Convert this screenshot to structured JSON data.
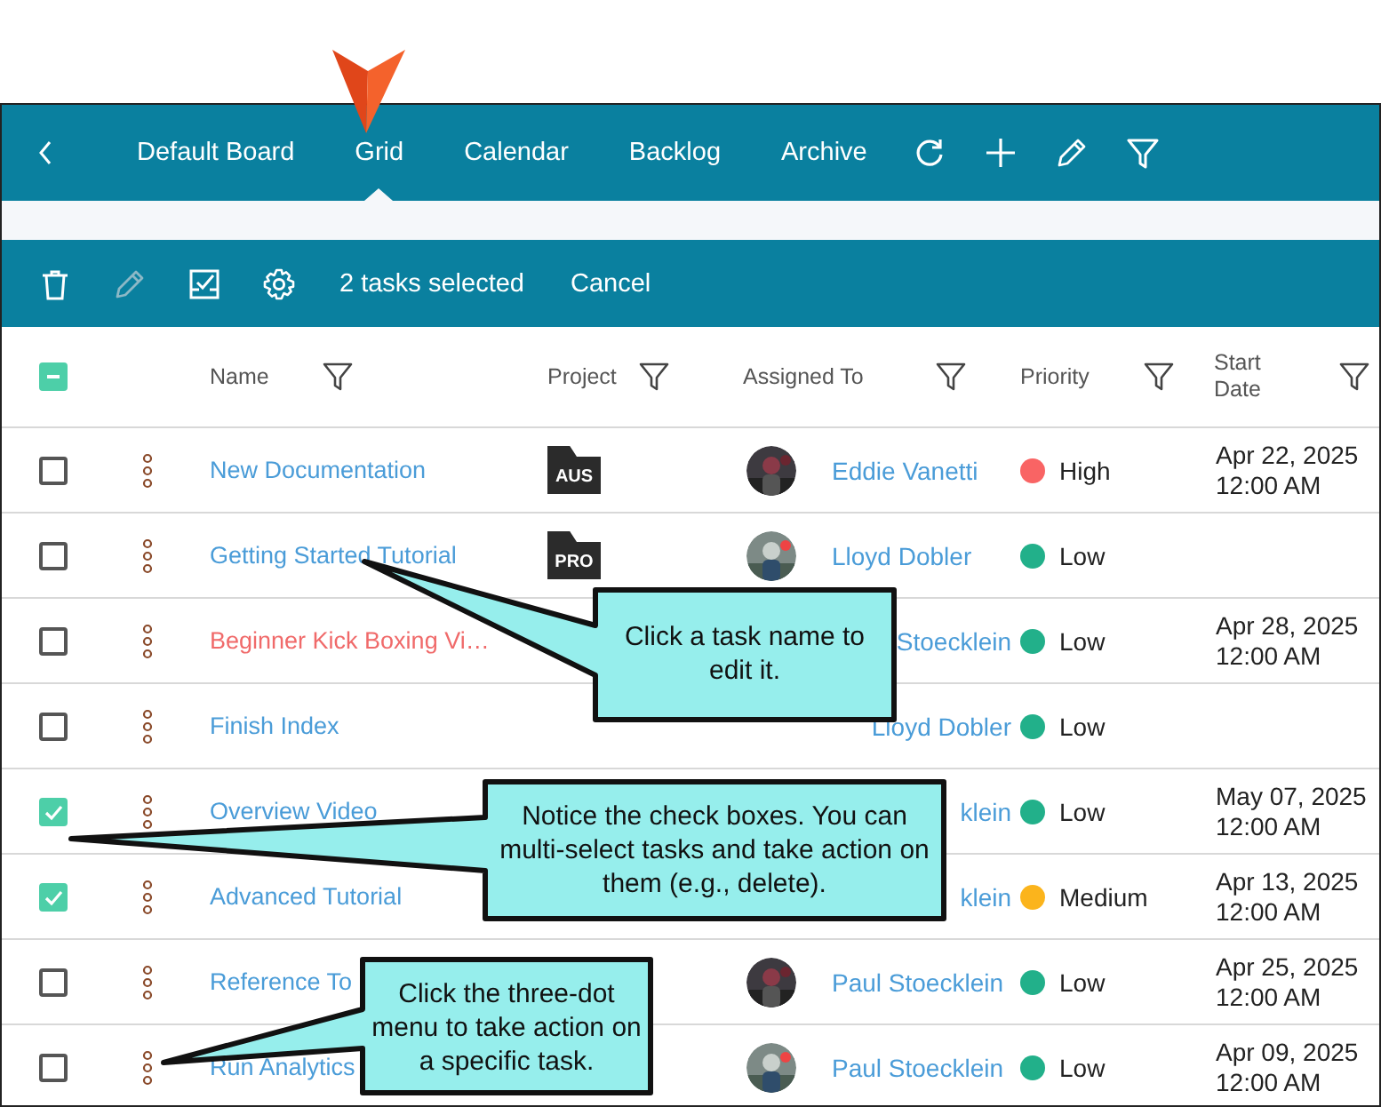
{
  "nav": {
    "tabs": [
      {
        "label": "Default Board",
        "selected": false
      },
      {
        "label": "Grid",
        "selected": true
      },
      {
        "label": "Calendar",
        "selected": false
      },
      {
        "label": "Backlog",
        "selected": false
      },
      {
        "label": "Archive",
        "selected": false
      }
    ]
  },
  "toolbar": {
    "edit_disabled": true,
    "selection_text": "2 tasks selected",
    "cancel": "Cancel"
  },
  "table": {
    "select_all_indeterminate": true,
    "columns": [
      "Name",
      "Project",
      "Assigned To",
      "Priority",
      "Start Date"
    ],
    "rows": [
      {
        "checked": false,
        "name": "New Documentation",
        "alert": false,
        "project": "AUS",
        "avatar": true,
        "assignee": "Eddie Vanetti",
        "priority": {
          "label": "High",
          "color": "#f96464"
        },
        "start_date": "Apr 22, 2025 12:00 AM"
      },
      {
        "checked": false,
        "name": "Getting Started Tutorial",
        "alert": false,
        "project": "PRO",
        "avatar": true,
        "assignee": "Lloyd Dobler",
        "priority": {
          "label": "Low",
          "color": "#22b08a"
        }
      },
      {
        "checked": false,
        "name": "Beginner Kick Boxing Vi…",
        "alert": true,
        "avatar": false,
        "assignee": "Stoecklein",
        "priority": {
          "label": "Low",
          "color": "#22b08a"
        },
        "start_date": "Apr 28, 2025 12:00 AM"
      },
      {
        "checked": false,
        "name": "Finish Index",
        "alert": false,
        "avatar": false,
        "assignee": "Lloyd Dobler",
        "priority": {
          "label": "Low",
          "color": "#22b08a"
        }
      },
      {
        "checked": true,
        "name": "Overview Video",
        "alert": false,
        "avatar": false,
        "assignee": "klein",
        "priority": {
          "label": "Low",
          "color": "#22b08a"
        },
        "start_date": "May 07, 2025 12:00 AM"
      },
      {
        "checked": true,
        "name": "Advanced Tutorial",
        "alert": false,
        "avatar": false,
        "assignee": "klein",
        "priority": {
          "label": "Medium",
          "color": "#fbb41c"
        },
        "start_date": "Apr 13, 2025 12:00 AM"
      },
      {
        "checked": false,
        "name": "Reference To",
        "alert": false,
        "avatar": true,
        "assignee": "Paul Stoecklein",
        "priority": {
          "label": "Low",
          "color": "#22b08a"
        },
        "start_date": "Apr 25, 2025 12:00 AM"
      },
      {
        "checked": false,
        "name": "Run Analytics",
        "alert": false,
        "avatar": true,
        "assignee": "Paul Stoecklein",
        "priority": {
          "label": "Low",
          "color": "#22b08a"
        },
        "start_date": "Apr 09, 2025 12:00 AM"
      }
    ]
  },
  "callouts": [
    {
      "text": "Click a task name to edit it."
    },
    {
      "text": "Notice the check boxes. You can multi-select tasks and take action on them (e.g., delete)."
    },
    {
      "text": "Click the three-dot menu to take action on a specific task."
    }
  ]
}
